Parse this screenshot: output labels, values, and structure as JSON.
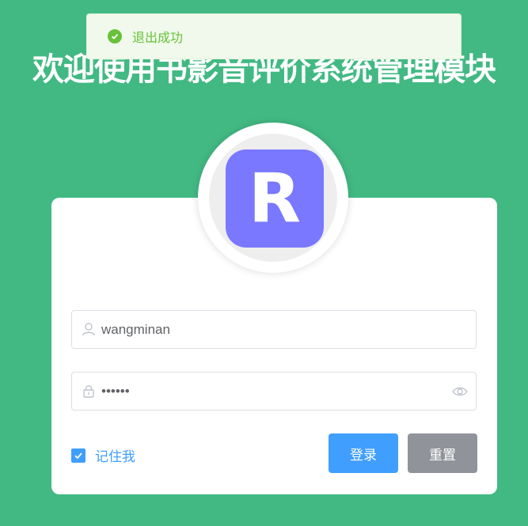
{
  "toast": {
    "message": "退出成功",
    "icon": "success-check-icon",
    "color": "#67c23a"
  },
  "header": {
    "title": "欢迎使用书影音评价系统管理模块"
  },
  "logo": {
    "letter": "R",
    "color": "#7a78ff"
  },
  "form": {
    "username": {
      "value": "wangminan",
      "icon": "user-icon"
    },
    "password": {
      "value": "••••••",
      "icon": "lock-icon",
      "toggle_icon": "eye-icon"
    },
    "remember": {
      "label": "记住我",
      "checked": true
    },
    "login_label": "登录",
    "reset_label": "重置"
  },
  "colors": {
    "background": "#42b983",
    "primary": "#409eff",
    "info": "#909399"
  }
}
